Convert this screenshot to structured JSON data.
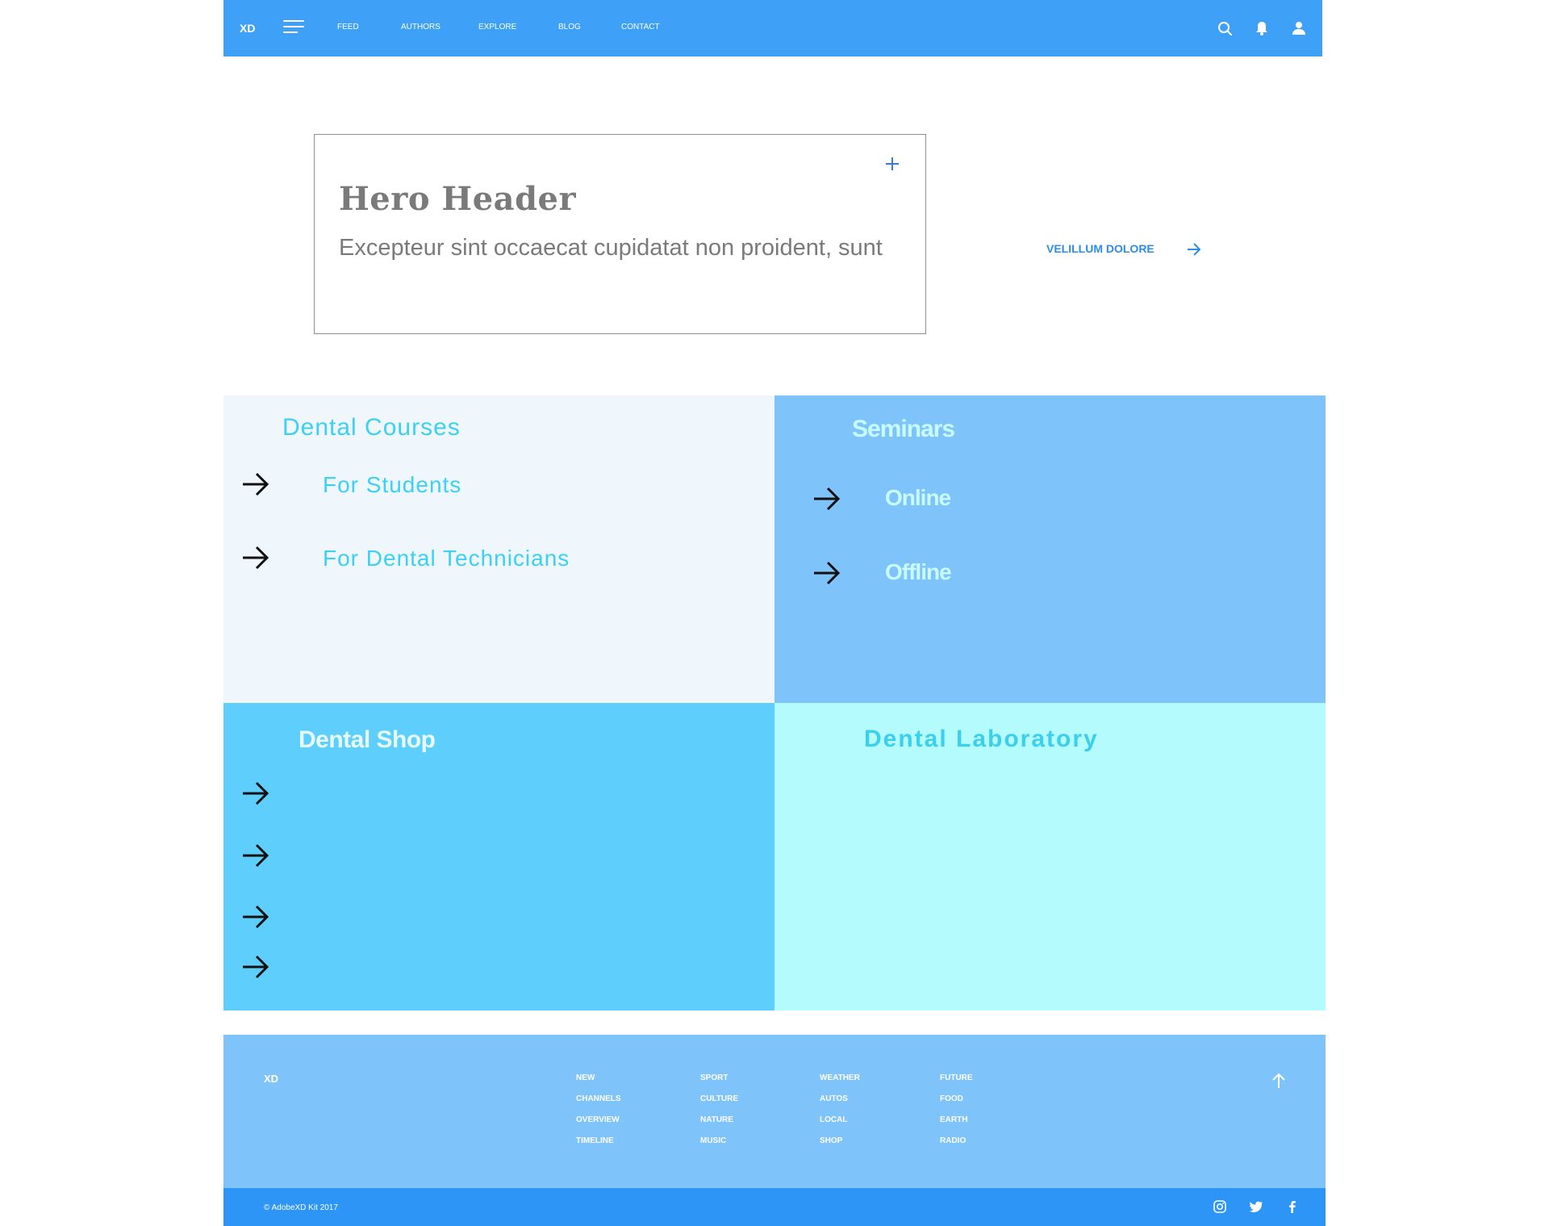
{
  "topnav": {
    "logo": "XD",
    "links": [
      "FEED",
      "AUTHORS",
      "EXPLORE",
      "BLOG",
      "CONTACT"
    ],
    "icons": [
      "search-icon",
      "bell-icon",
      "user-icon"
    ],
    "color": "#3ea1f7"
  },
  "hero": {
    "title": "Hero Header",
    "subtitle": "Excepteur sint occaecat cupidatat non proident, sunt",
    "cta": "VELILLUM DOLORE"
  },
  "sections": {
    "courses": {
      "title": "Dental Courses",
      "items": [
        "For Students",
        "For Dental Technicians"
      ],
      "bg": "#eff6fc"
    },
    "seminars": {
      "title": "Seminars",
      "items": [
        "Online",
        "Offline"
      ],
      "bg": "#7fc3fb"
    },
    "shop": {
      "title": "Dental Shop",
      "bg": "#5ecffc"
    },
    "laboratory": {
      "title": "Dental Laboratory",
      "bg": "#b4fbfd"
    }
  },
  "footer": {
    "logo": "XD",
    "columns": [
      [
        "NEW",
        "CHANNELS",
        "OVERVIEW",
        "TIMELINE"
      ],
      [
        "SPORT",
        "CULTURE",
        "NATURE",
        "MUSIC"
      ],
      [
        "WEATHER",
        "AUTOS",
        "LOCAL",
        "SHOP"
      ],
      [
        "FUTURE",
        "FOOD",
        "EARTH",
        "RADIO"
      ]
    ],
    "copyright": "© AdobeXD Kit 2017",
    "social": [
      "instagram-icon",
      "twitter-icon",
      "facebook-icon"
    ]
  }
}
